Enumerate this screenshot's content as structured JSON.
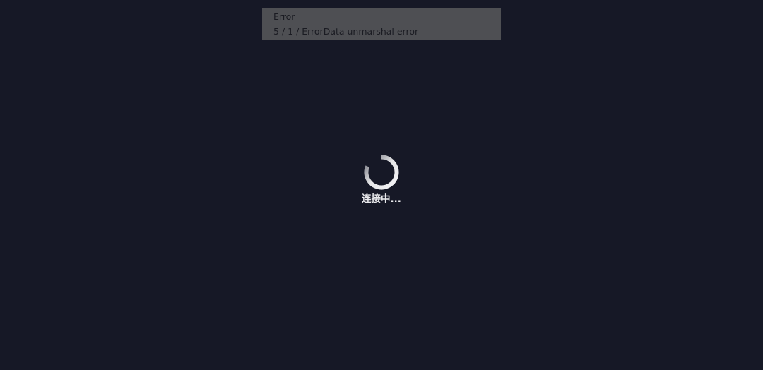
{
  "error": {
    "title": "Error",
    "message": "5 / 1 / ErrorData unmarshal error"
  },
  "loader": {
    "label": "连接中..."
  },
  "colors": {
    "background": "#161826",
    "banner": "#4e4f53",
    "spinner": "#e6e6e8",
    "text": "#e9e9ec"
  }
}
